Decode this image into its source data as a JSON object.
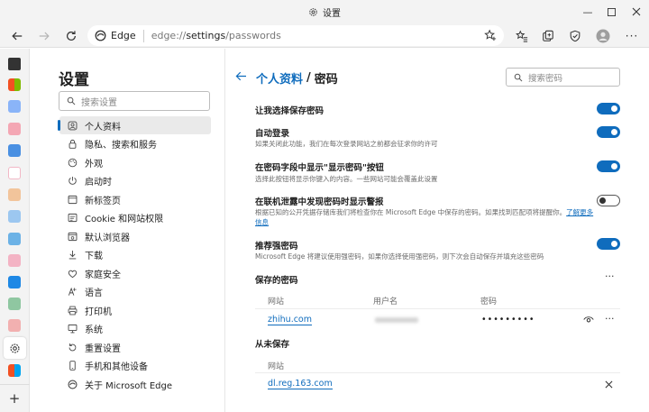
{
  "window": {
    "title": "设置"
  },
  "toolbar": {
    "edge_label": "Edge",
    "url_prefix": "edge://",
    "url_path": "settings",
    "url_suffix": "/passwords"
  },
  "nav": {
    "title": "设置",
    "search_placeholder": "搜索设置",
    "items": [
      {
        "label": "个人资料",
        "icon": "profile-icon"
      },
      {
        "label": "隐私、搜索和服务",
        "icon": "lock-icon"
      },
      {
        "label": "外观",
        "icon": "appearance-icon"
      },
      {
        "label": "启动时",
        "icon": "power-icon"
      },
      {
        "label": "新标签页",
        "icon": "new-tab-icon"
      },
      {
        "label": "Cookie 和网站权限",
        "icon": "site-permissions-icon"
      },
      {
        "label": "默认浏览器",
        "icon": "browser-icon"
      },
      {
        "label": "下载",
        "icon": "download-icon"
      },
      {
        "label": "家庭安全",
        "icon": "family-icon"
      },
      {
        "label": "语言",
        "icon": "language-icon"
      },
      {
        "label": "打印机",
        "icon": "printer-icon"
      },
      {
        "label": "系统",
        "icon": "system-icon"
      },
      {
        "label": "重置设置",
        "icon": "reset-icon"
      },
      {
        "label": "手机和其他设备",
        "icon": "phone-icon"
      },
      {
        "label": "关于 Microsoft Edge",
        "icon": "edge-logo-icon"
      }
    ]
  },
  "main": {
    "breadcrumb_parent": "个人资料",
    "breadcrumb_sep": "/",
    "breadcrumb_current": "密码",
    "search_placeholder": "搜索密码",
    "settings": [
      {
        "title": "让我选择保存密码",
        "desc": "",
        "on": true
      },
      {
        "title": "自动登录",
        "desc": "如果关闭此功能，我们在每次登录网站之前都会征求你的许可",
        "on": true
      },
      {
        "title": "在密码字段中显示\"显示密码\"按钮",
        "desc": "选择此按钮将显示你键入的内容。一些网站可能会覆盖此设置",
        "on": true
      },
      {
        "title": "在联机泄露中发现密码时显示警报",
        "desc": "根据已知的公开凭据存储库我们将检查你在 Microsoft Edge 中保存的密码。如果找到匹配项将提醒你。",
        "desc_link": "了解更多信息",
        "on": false
      },
      {
        "title": "推荐强密码",
        "desc": "Microsoft Edge 将建议使用强密码，如果你选择使用强密码，则下次会自动保存并填充这些密码",
        "on": true
      }
    ],
    "saved": {
      "title": "保存的密码",
      "col_site": "网站",
      "col_user": "用户名",
      "col_password": "密码",
      "rows": [
        {
          "site": "zhihu.com",
          "password": "•••••••••"
        }
      ]
    },
    "never": {
      "title": "从未保存",
      "col_site": "网站",
      "rows": [
        {
          "site": "dl.reg.163.com"
        }
      ]
    }
  },
  "colors": {
    "accent": "#0f6cbd",
    "chrome": "#f3f3f3"
  }
}
